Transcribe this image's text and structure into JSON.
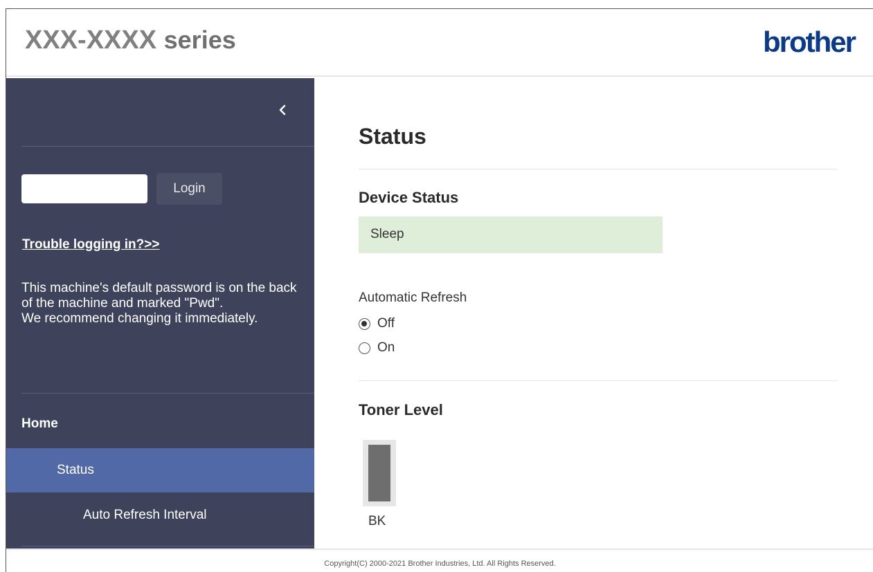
{
  "header": {
    "model": "XXX-XXXX",
    "series": "series",
    "logo": "brother"
  },
  "sidebar": {
    "collapse_icon": "chevron-left-icon",
    "login": {
      "password_value": "",
      "button_label": "Login"
    },
    "trouble_link": "Trouble logging in?>>",
    "notice_line1": "This machine's default password is on the back of the machine and marked \"Pwd\".",
    "notice_line2": "We recommend changing it immediately.",
    "nav": {
      "home": "Home",
      "status": "Status",
      "auto_refresh": "Auto Refresh Interval"
    }
  },
  "main": {
    "title": "Status",
    "device_status": {
      "heading": "Device Status",
      "value": "Sleep",
      "color": "#dfeed8"
    },
    "auto_refresh": {
      "label": "Automatic Refresh",
      "options": [
        "Off",
        "On"
      ],
      "selected": "Off"
    },
    "toner": {
      "heading": "Toner Level",
      "items": [
        {
          "label": "BK",
          "level": 1.0
        }
      ]
    }
  },
  "footer": {
    "copyright": "Copyright(C) 2000-2021 Brother Industries, Ltd. All Rights Reserved."
  },
  "colors": {
    "sidebar_bg": "#3e435b",
    "nav_active": "#5169a6",
    "logo": "#0b3a8c"
  }
}
